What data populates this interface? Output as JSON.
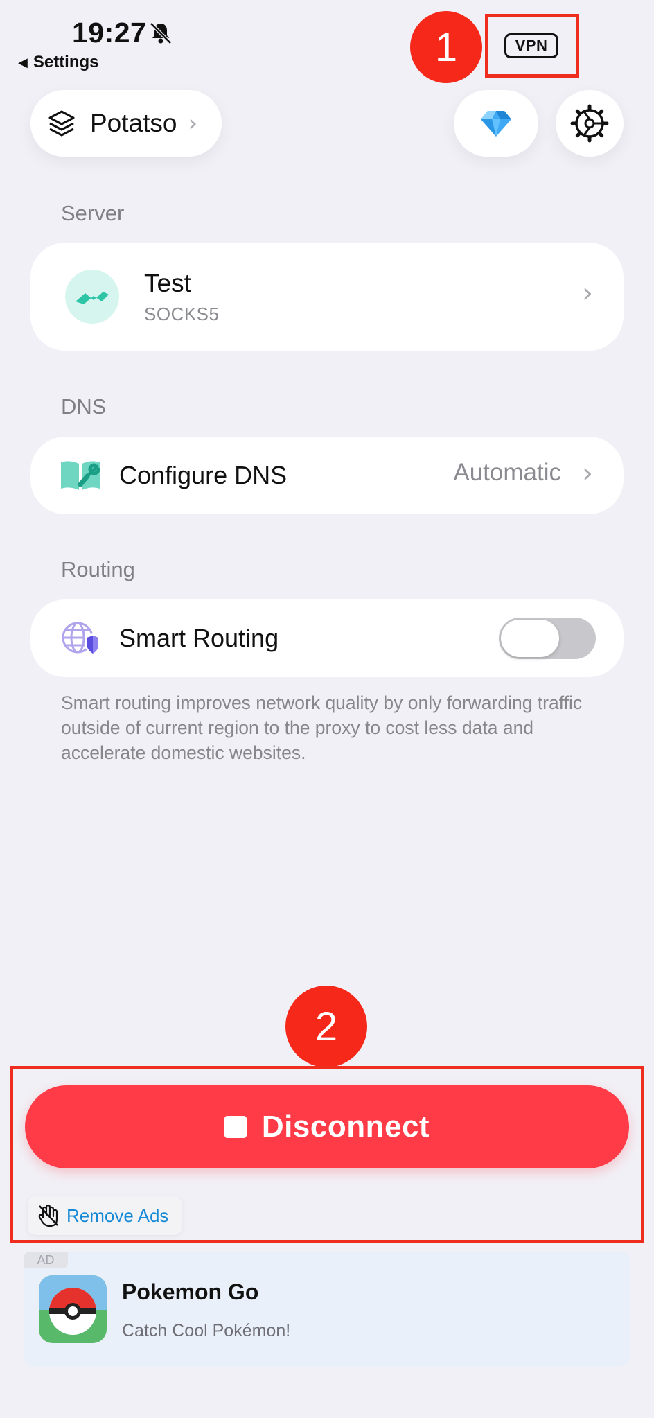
{
  "status_bar": {
    "time": "19:27",
    "back_label": "Settings",
    "vpn_badge": "VPN"
  },
  "annotations": {
    "marker_1": "1",
    "marker_2": "2",
    "color": "#f5281a"
  },
  "header": {
    "profile_label": "Potatso",
    "profile_icon": "layers-icon",
    "premium_icon": "diamond-icon",
    "settings_icon": "gear-icon"
  },
  "server": {
    "section_title": "Server",
    "name": "Test",
    "protocol": "SOCKS5",
    "icon": "server-wave-icon"
  },
  "dns": {
    "section_title": "DNS",
    "label": "Configure DNS",
    "value": "Automatic",
    "icon": "dns-book-wrench-icon"
  },
  "routing": {
    "section_title": "Routing",
    "label": "Smart Routing",
    "enabled": false,
    "description": "Smart routing improves network quality by only forwarding traffic outside of current region to the proxy to cost less data and accelerate domestic websites.",
    "icon": "globe-shield-icon"
  },
  "actions": {
    "disconnect_label": "Disconnect",
    "disconnect_color": "#ff3b47",
    "remove_ads_label": "Remove Ads"
  },
  "ad": {
    "tag": "AD",
    "title": "Pokemon Go",
    "subtitle": "Catch Cool Pokémon!"
  }
}
